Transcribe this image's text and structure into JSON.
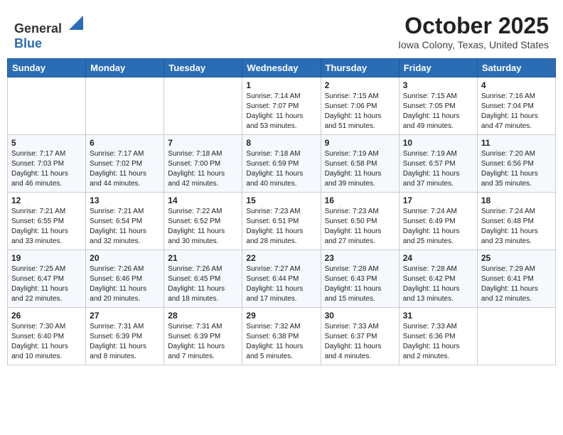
{
  "header": {
    "logo_line1": "General",
    "logo_line2": "Blue",
    "month": "October 2025",
    "location": "Iowa Colony, Texas, United States"
  },
  "weekdays": [
    "Sunday",
    "Monday",
    "Tuesday",
    "Wednesday",
    "Thursday",
    "Friday",
    "Saturday"
  ],
  "weeks": [
    [
      {
        "day": "",
        "info": ""
      },
      {
        "day": "",
        "info": ""
      },
      {
        "day": "",
        "info": ""
      },
      {
        "day": "1",
        "info": "Sunrise: 7:14 AM\nSunset: 7:07 PM\nDaylight: 11 hours\nand 53 minutes."
      },
      {
        "day": "2",
        "info": "Sunrise: 7:15 AM\nSunset: 7:06 PM\nDaylight: 11 hours\nand 51 minutes."
      },
      {
        "day": "3",
        "info": "Sunrise: 7:15 AM\nSunset: 7:05 PM\nDaylight: 11 hours\nand 49 minutes."
      },
      {
        "day": "4",
        "info": "Sunrise: 7:16 AM\nSunset: 7:04 PM\nDaylight: 11 hours\nand 47 minutes."
      }
    ],
    [
      {
        "day": "5",
        "info": "Sunrise: 7:17 AM\nSunset: 7:03 PM\nDaylight: 11 hours\nand 46 minutes."
      },
      {
        "day": "6",
        "info": "Sunrise: 7:17 AM\nSunset: 7:02 PM\nDaylight: 11 hours\nand 44 minutes."
      },
      {
        "day": "7",
        "info": "Sunrise: 7:18 AM\nSunset: 7:00 PM\nDaylight: 11 hours\nand 42 minutes."
      },
      {
        "day": "8",
        "info": "Sunrise: 7:18 AM\nSunset: 6:59 PM\nDaylight: 11 hours\nand 40 minutes."
      },
      {
        "day": "9",
        "info": "Sunrise: 7:19 AM\nSunset: 6:58 PM\nDaylight: 11 hours\nand 39 minutes."
      },
      {
        "day": "10",
        "info": "Sunrise: 7:19 AM\nSunset: 6:57 PM\nDaylight: 11 hours\nand 37 minutes."
      },
      {
        "day": "11",
        "info": "Sunrise: 7:20 AM\nSunset: 6:56 PM\nDaylight: 11 hours\nand 35 minutes."
      }
    ],
    [
      {
        "day": "12",
        "info": "Sunrise: 7:21 AM\nSunset: 6:55 PM\nDaylight: 11 hours\nand 33 minutes."
      },
      {
        "day": "13",
        "info": "Sunrise: 7:21 AM\nSunset: 6:54 PM\nDaylight: 11 hours\nand 32 minutes."
      },
      {
        "day": "14",
        "info": "Sunrise: 7:22 AM\nSunset: 6:52 PM\nDaylight: 11 hours\nand 30 minutes."
      },
      {
        "day": "15",
        "info": "Sunrise: 7:23 AM\nSunset: 6:51 PM\nDaylight: 11 hours\nand 28 minutes."
      },
      {
        "day": "16",
        "info": "Sunrise: 7:23 AM\nSunset: 6:50 PM\nDaylight: 11 hours\nand 27 minutes."
      },
      {
        "day": "17",
        "info": "Sunrise: 7:24 AM\nSunset: 6:49 PM\nDaylight: 11 hours\nand 25 minutes."
      },
      {
        "day": "18",
        "info": "Sunrise: 7:24 AM\nSunset: 6:48 PM\nDaylight: 11 hours\nand 23 minutes."
      }
    ],
    [
      {
        "day": "19",
        "info": "Sunrise: 7:25 AM\nSunset: 6:47 PM\nDaylight: 11 hours\nand 22 minutes."
      },
      {
        "day": "20",
        "info": "Sunrise: 7:26 AM\nSunset: 6:46 PM\nDaylight: 11 hours\nand 20 minutes."
      },
      {
        "day": "21",
        "info": "Sunrise: 7:26 AM\nSunset: 6:45 PM\nDaylight: 11 hours\nand 18 minutes."
      },
      {
        "day": "22",
        "info": "Sunrise: 7:27 AM\nSunset: 6:44 PM\nDaylight: 11 hours\nand 17 minutes."
      },
      {
        "day": "23",
        "info": "Sunrise: 7:28 AM\nSunset: 6:43 PM\nDaylight: 11 hours\nand 15 minutes."
      },
      {
        "day": "24",
        "info": "Sunrise: 7:28 AM\nSunset: 6:42 PM\nDaylight: 11 hours\nand 13 minutes."
      },
      {
        "day": "25",
        "info": "Sunrise: 7:29 AM\nSunset: 6:41 PM\nDaylight: 11 hours\nand 12 minutes."
      }
    ],
    [
      {
        "day": "26",
        "info": "Sunrise: 7:30 AM\nSunset: 6:40 PM\nDaylight: 11 hours\nand 10 minutes."
      },
      {
        "day": "27",
        "info": "Sunrise: 7:31 AM\nSunset: 6:39 PM\nDaylight: 11 hours\nand 8 minutes."
      },
      {
        "day": "28",
        "info": "Sunrise: 7:31 AM\nSunset: 6:39 PM\nDaylight: 11 hours\nand 7 minutes."
      },
      {
        "day": "29",
        "info": "Sunrise: 7:32 AM\nSunset: 6:38 PM\nDaylight: 11 hours\nand 5 minutes."
      },
      {
        "day": "30",
        "info": "Sunrise: 7:33 AM\nSunset: 6:37 PM\nDaylight: 11 hours\nand 4 minutes."
      },
      {
        "day": "31",
        "info": "Sunrise: 7:33 AM\nSunset: 6:36 PM\nDaylight: 11 hours\nand 2 minutes."
      },
      {
        "day": "",
        "info": ""
      }
    ]
  ]
}
